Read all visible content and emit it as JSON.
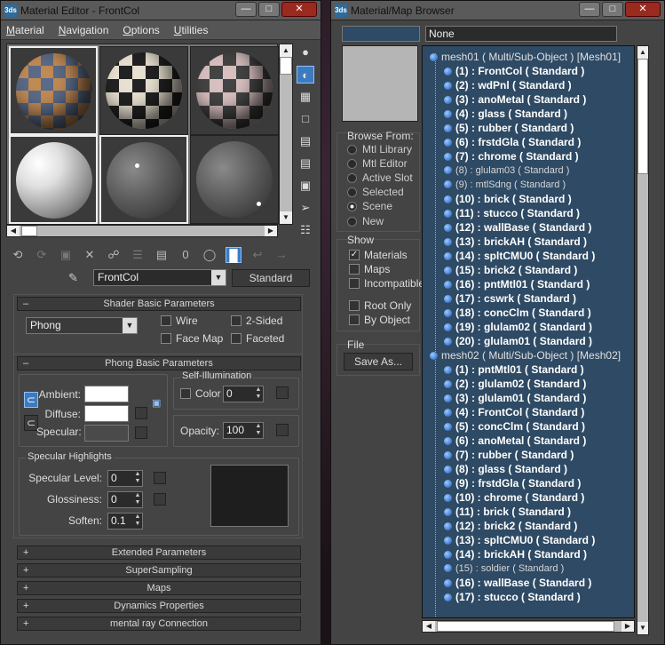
{
  "material_editor": {
    "title": "Material Editor - FrontCol",
    "app_icon": "3ds",
    "menu": [
      "Material",
      "Navigation",
      "Options",
      "Utilities"
    ],
    "material_name": "FrontCol",
    "material_type": "Standard",
    "zero_label": "0",
    "shader": {
      "header": "Shader Basic Parameters",
      "type": "Phong",
      "wire": "Wire",
      "two_sided": "2-Sided",
      "face_map": "Face Map",
      "faceted": "Faceted"
    },
    "phong": {
      "header": "Phong Basic Parameters",
      "ambient": "Ambient:",
      "diffuse": "Diffuse:",
      "specular": "Specular:",
      "self_illum_title": "Self-Illumination",
      "color": "Color",
      "color_value": "0",
      "opacity": "Opacity:",
      "opacity_value": "100",
      "spec_highlights_title": "Specular Highlights",
      "spec_level": "Specular Level:",
      "spec_level_value": "0",
      "glossiness": "Glossiness:",
      "glossiness_value": "0",
      "soften": "Soften:",
      "soften_value": "0.1"
    },
    "rollouts": [
      "Extended Parameters",
      "SuperSampling",
      "Maps",
      "Dynamics Properties",
      "mental ray Connection"
    ],
    "colors": {
      "ambient": "#ffffff",
      "diffuse": "#ffffff",
      "specular": "#4a4a4a",
      "preview": "#1e1e1e"
    }
  },
  "browser": {
    "title": "Material/Map Browser",
    "app_icon": "3ds",
    "search_value": "None",
    "browse_from": {
      "title": "Browse From:",
      "options": [
        "Mtl Library",
        "Mtl Editor",
        "Active Slot",
        "Selected",
        "Scene",
        "New"
      ],
      "selected": "Scene"
    },
    "show": {
      "title": "Show",
      "materials": "Materials",
      "maps": "Maps",
      "incompatible": "Incompatible",
      "root_only": "Root Only",
      "by_object": "By Object"
    },
    "file": {
      "title": "File",
      "save_as": "Save As..."
    },
    "tree": [
      {
        "text": "mesh01  ( Multi/Sub-Object )  [Mesh01]",
        "kind": "parent"
      },
      {
        "text": "(1) : FrontCol  ( Standard )",
        "kind": "bold"
      },
      {
        "text": "(2) : wdPnl  ( Standard )",
        "kind": "bold"
      },
      {
        "text": "(3) : anoMetal  ( Standard )",
        "kind": "bold"
      },
      {
        "text": "(4) : glass  ( Standard )",
        "kind": "bold"
      },
      {
        "text": "(5) : rubber  ( Standard )",
        "kind": "bold"
      },
      {
        "text": "(6) : frstdGla  ( Standard )",
        "kind": "bold"
      },
      {
        "text": "(7) : chrome  ( Standard )",
        "kind": "bold"
      },
      {
        "text": "(8) : glulam03  ( Standard )",
        "kind": "plain"
      },
      {
        "text": "(9) : mtlSdng  ( Standard )",
        "kind": "plain"
      },
      {
        "text": "(10) : brick  ( Standard )",
        "kind": "bold"
      },
      {
        "text": "(11) : stucco  ( Standard )",
        "kind": "bold"
      },
      {
        "text": "(12) : wallBase  ( Standard )",
        "kind": "bold"
      },
      {
        "text": "(13) : brickAH  ( Standard )",
        "kind": "bold"
      },
      {
        "text": "(14) : spltCMU0  ( Standard )",
        "kind": "bold"
      },
      {
        "text": "(15) : brick2  ( Standard )",
        "kind": "bold"
      },
      {
        "text": "(16) : pntMtl01  ( Standard )",
        "kind": "bold"
      },
      {
        "text": "(17) : cswrk  ( Standard )",
        "kind": "bold"
      },
      {
        "text": "(18) : concClm  ( Standard )",
        "kind": "bold"
      },
      {
        "text": "(19) : glulam02  ( Standard )",
        "kind": "bold"
      },
      {
        "text": "(20) : glulam01  ( Standard )",
        "kind": "bold"
      },
      {
        "text": "mesh02  ( Multi/Sub-Object )  [Mesh02]",
        "kind": "parent"
      },
      {
        "text": "(1) : pntMtl01  ( Standard )",
        "kind": "bold"
      },
      {
        "text": "(2) : glulam02  ( Standard )",
        "kind": "bold"
      },
      {
        "text": "(3) : glulam01  ( Standard )",
        "kind": "bold"
      },
      {
        "text": "(4) : FrontCol  ( Standard )",
        "kind": "bold"
      },
      {
        "text": "(5) : concClm  ( Standard )",
        "kind": "bold"
      },
      {
        "text": "(6) : anoMetal  ( Standard )",
        "kind": "bold"
      },
      {
        "text": "(7) : rubber  ( Standard )",
        "kind": "bold"
      },
      {
        "text": "(8) : glass  ( Standard )",
        "kind": "bold"
      },
      {
        "text": "(9) : frstdGla  ( Standard )",
        "kind": "bold"
      },
      {
        "text": "(10) : chrome  ( Standard )",
        "kind": "bold"
      },
      {
        "text": "(11) : brick  ( Standard )",
        "kind": "bold"
      },
      {
        "text": "(12) : brick2  ( Standard )",
        "kind": "bold"
      },
      {
        "text": "(13) : spltCMU0  ( Standard )",
        "kind": "bold"
      },
      {
        "text": "(14) : brickAH  ( Standard )",
        "kind": "bold"
      },
      {
        "text": "(15) : soldier  ( Standard )",
        "kind": "plain"
      },
      {
        "text": "(16) : wallBase  ( Standard )",
        "kind": "bold"
      },
      {
        "text": "(17) : stucco  ( Standard )",
        "kind": "bold"
      }
    ]
  }
}
